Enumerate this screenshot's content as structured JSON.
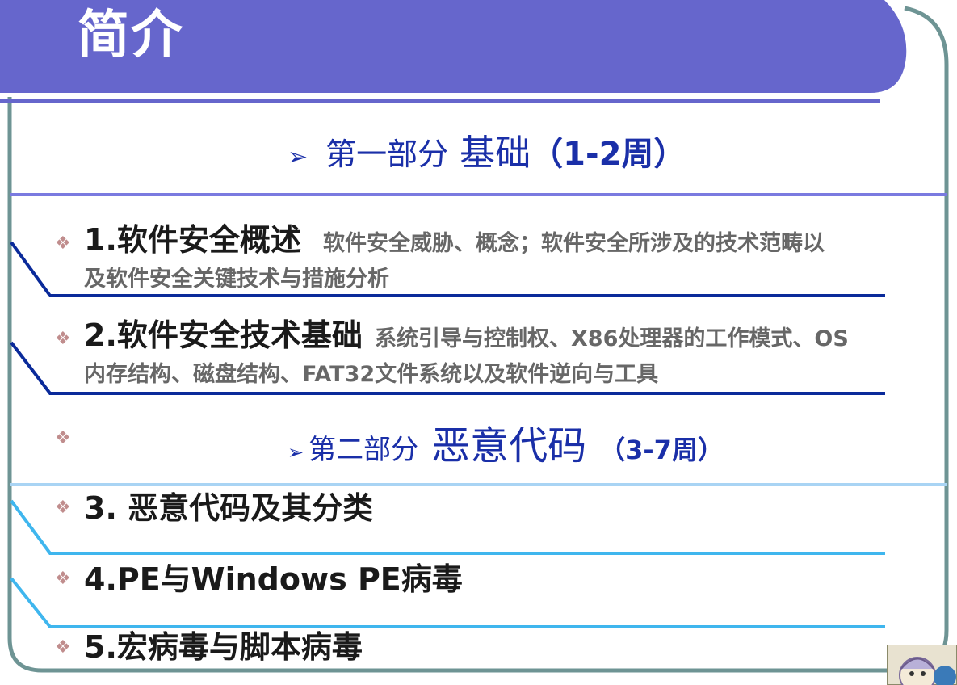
{
  "title": "简介",
  "section1": {
    "arrow": "➢",
    "part": "第一部分",
    "name": "基础",
    "weeks": "（1-2周）"
  },
  "section2": {
    "arrow": "➢",
    "part": "第二部分",
    "name": "恶意代码",
    "weeks": "（3-7周）"
  },
  "bullet": "❖",
  "items": [
    {
      "title": "1.软件安全概述",
      "desc_line1": "软件安全威胁、概念；软件安全所涉及的技术范畴以",
      "desc_line2": "及软件安全关键技术与措施分析"
    },
    {
      "title": "2.软件安全技术基础",
      "desc_line1": "系统引导与控制权、X86处理器的工作模式、OS",
      "desc_line2": "内存结构、磁盘结构、FAT32文件系统以及软件逆向与工具"
    },
    {
      "title": "3. 恶意代码及其分类"
    },
    {
      "title": "4.PE与Windows PE病毒"
    },
    {
      "title": "5.宏病毒与脚本病毒"
    }
  ],
  "colors": {
    "header": "#6666cc",
    "frame": "#6e9494",
    "rule_dark": "#0a2a9a",
    "rule_light": "#3fb6ee",
    "section_text": "#1a2fa8",
    "bullet": "#c08d8d"
  }
}
